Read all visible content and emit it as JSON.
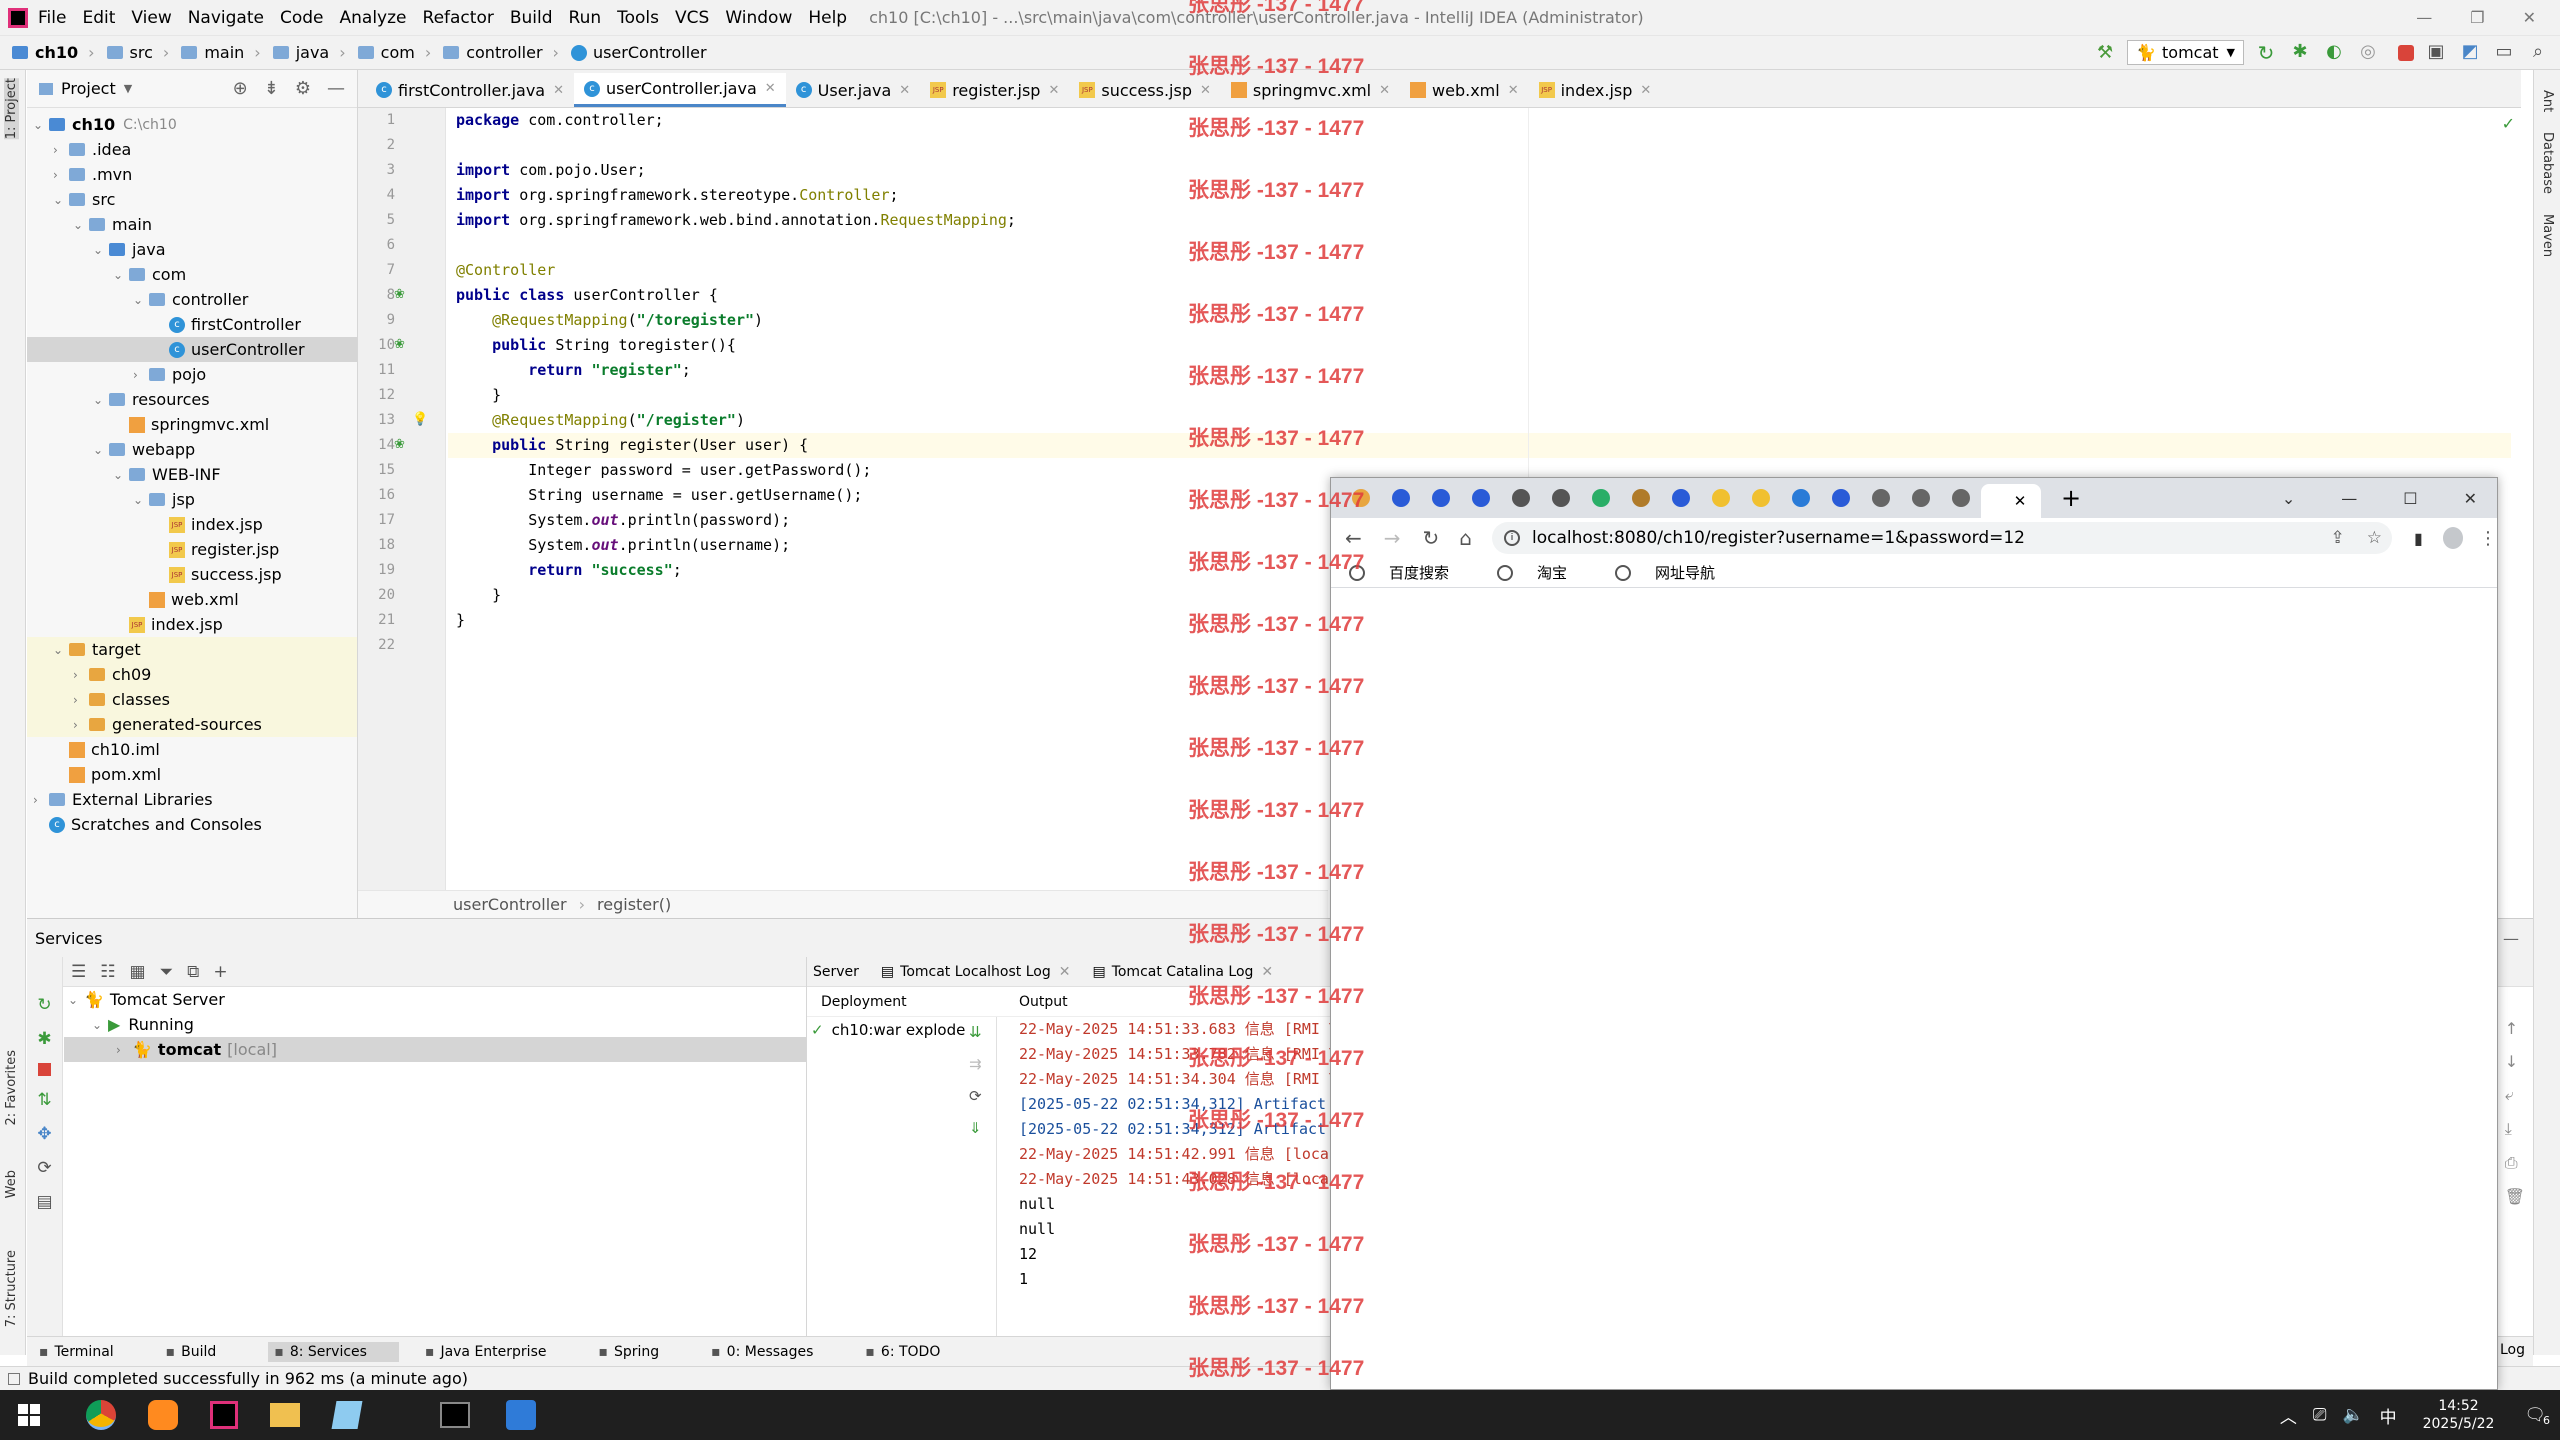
{
  "ide": {
    "menu": [
      "File",
      "Edit",
      "View",
      "Navigate",
      "Code",
      "Analyze",
      "Refactor",
      "Build",
      "Run",
      "Tools",
      "VCS",
      "Window",
      "Help"
    ],
    "title": "ch10 [C:\\ch10] - ...\\src\\main\\java\\com\\controller\\userController.java - IntelliJ IDEA (Administrator)",
    "breadcrumbs": [
      "ch10",
      "src",
      "main",
      "java",
      "com",
      "controller",
      "userController"
    ],
    "run_config": "tomcat",
    "project_label": "Project",
    "tabs": [
      "firstController.java",
      "userController.java",
      "User.java",
      "register.jsp",
      "success.jsp",
      "springmvc.xml",
      "web.xml",
      "index.jsp"
    ],
    "active_tab": 1,
    "tree": [
      {
        "label": "ch10",
        "hint": "C:\\ch10",
        "depth": 0,
        "type": "folder-b",
        "open": true,
        "bold": true
      },
      {
        "label": ".idea",
        "depth": 1,
        "type": "folder",
        "arrow": "closed"
      },
      {
        "label": ".mvn",
        "depth": 1,
        "type": "folder",
        "arrow": "closed"
      },
      {
        "label": "src",
        "depth": 1,
        "type": "folder",
        "arrow": "open"
      },
      {
        "label": "main",
        "depth": 2,
        "type": "folder",
        "arrow": "open"
      },
      {
        "label": "java",
        "depth": 3,
        "type": "folder-b",
        "arrow": "open"
      },
      {
        "label": "com",
        "depth": 4,
        "type": "folder",
        "arrow": "open"
      },
      {
        "label": "controller",
        "depth": 5,
        "type": "folder",
        "arrow": "open"
      },
      {
        "label": "firstController",
        "depth": 6,
        "type": "java"
      },
      {
        "label": "userController",
        "depth": 6,
        "type": "java",
        "selected": true
      },
      {
        "label": "pojo",
        "depth": 5,
        "type": "folder",
        "arrow": "closed"
      },
      {
        "label": "resources",
        "depth": 3,
        "type": "folder",
        "arrow": "open"
      },
      {
        "label": "springmvc.xml",
        "depth": 4,
        "type": "xml"
      },
      {
        "label": "webapp",
        "depth": 3,
        "type": "folder",
        "arrow": "open"
      },
      {
        "label": "WEB-INF",
        "depth": 4,
        "type": "folder",
        "arrow": "open"
      },
      {
        "label": "jsp",
        "depth": 5,
        "type": "folder",
        "arrow": "open"
      },
      {
        "label": "index.jsp",
        "depth": 6,
        "type": "jsp"
      },
      {
        "label": "register.jsp",
        "depth": 6,
        "type": "jsp"
      },
      {
        "label": "success.jsp",
        "depth": 6,
        "type": "jsp"
      },
      {
        "label": "web.xml",
        "depth": 5,
        "type": "xml"
      },
      {
        "label": "index.jsp",
        "depth": 4,
        "type": "jsp"
      },
      {
        "label": "target",
        "depth": 1,
        "type": "folder-o",
        "arrow": "open",
        "excluded": true
      },
      {
        "label": "ch09",
        "depth": 2,
        "type": "folder-o",
        "arrow": "closed",
        "excluded": true
      },
      {
        "label": "classes",
        "depth": 2,
        "type": "folder-o",
        "arrow": "closed",
        "excluded": true
      },
      {
        "label": "generated-sources",
        "depth": 2,
        "type": "folder-o",
        "arrow": "closed",
        "excluded": true
      },
      {
        "label": "ch10.iml",
        "depth": 1,
        "type": "file"
      },
      {
        "label": "pom.xml",
        "depth": 1,
        "type": "file"
      },
      {
        "label": "External Libraries",
        "depth": 0,
        "type": "lib",
        "arrow": "closed"
      },
      {
        "label": "Scratches and Consoles",
        "depth": 0,
        "type": "scratch"
      }
    ],
    "code_lines": [
      [
        [
          "kw",
          "package"
        ],
        [
          "",
          "com.controller;"
        ]
      ],
      [],
      [
        [
          "kw",
          "import"
        ],
        [
          "",
          "com.pojo.User;"
        ]
      ],
      [
        [
          "kw",
          "import"
        ],
        [
          "",
          "org.springframework.stereotype."
        ],
        [
          "an",
          "Controller"
        ],
        [
          "",
          ";"
        ]
      ],
      [
        [
          "kw",
          "import"
        ],
        [
          "",
          "org.springframework.web.bind.annotation."
        ],
        [
          "an",
          "RequestMapping"
        ],
        [
          "",
          ";"
        ]
      ],
      [],
      [
        [
          "an",
          "@Controller"
        ]
      ],
      [
        [
          "kw",
          "public class"
        ],
        [
          "",
          " userController {"
        ]
      ],
      [
        [
          "",
          "    "
        ],
        [
          "an",
          "@RequestMapping"
        ],
        [
          "",
          "("
        ],
        [
          "st",
          "\"/toregister\""
        ],
        [
          "",
          ")"
        ]
      ],
      [
        [
          "",
          "    "
        ],
        [
          "kw",
          "public"
        ],
        [
          "",
          " String toregister(){"
        ]
      ],
      [
        [
          "",
          "        "
        ],
        [
          "kw",
          "return"
        ],
        [
          "",
          " "
        ],
        [
          "st",
          "\"register\""
        ],
        [
          "",
          ";"
        ]
      ],
      [
        [
          "",
          "    }"
        ]
      ],
      [
        [
          "",
          "    "
        ],
        [
          "an",
          "@RequestMapping"
        ],
        [
          "",
          "("
        ],
        [
          "st",
          "\"/register\""
        ],
        [
          "",
          ")"
        ]
      ],
      [
        [
          "",
          "    "
        ],
        [
          "kw",
          "public"
        ],
        [
          "",
          " String register(User user) {"
        ]
      ],
      [
        [
          "",
          "        Integer password = user.getPassword();"
        ]
      ],
      [
        [
          "",
          "        String username = user.getUsername();"
        ]
      ],
      [
        [
          "",
          "        System."
        ],
        [
          "fld",
          "out"
        ],
        [
          "",
          ".println(password);"
        ]
      ],
      [
        [
          "",
          "        System."
        ],
        [
          "fld",
          "out"
        ],
        [
          "",
          ".println(username);"
        ]
      ],
      [
        [
          "",
          "        "
        ],
        [
          "kw",
          "return"
        ],
        [
          "",
          " "
        ],
        [
          "st",
          "\"success\""
        ],
        [
          "",
          ";"
        ]
      ],
      [
        [
          "",
          "    }"
        ]
      ],
      [
        [
          "",
          "}"
        ]
      ],
      []
    ],
    "current_line": 14,
    "editor_breadcrumb": [
      "userController",
      "register()"
    ],
    "services": {
      "title": "Services",
      "tree": [
        "Tomcat Server",
        "Running",
        "tomcat"
      ],
      "tomcat_hint": "[local]",
      "tabs": [
        "Server",
        "Tomcat Localhost Log",
        "Tomcat Catalina Log"
      ],
      "deployment_label": "Deployment",
      "output_label": "Output",
      "deployment_item": "ch10:war explode",
      "output_lines": [
        {
          "text": "22-May-2025 14:51:33.683 信息 [RMI T",
          "color": "#c0392b"
        },
        {
          "text": "22-May-2025 14:51:33.782 信息 [RMI T",
          "color": "#c0392b"
        },
        {
          "text": "22-May-2025 14:51:34.304 信息 [RMI T",
          "color": "#c0392b"
        },
        {
          "text": "[2025-05-22 02:51:34,312] Artifact c",
          "color": "#1a4f9c"
        },
        {
          "text": "[2025-05-22 02:51:34,312] Artifact c",
          "color": "#1a4f9c"
        },
        {
          "text": "22-May-2025 14:51:42.991 信息 [local",
          "color": "#c0392b"
        },
        {
          "text": "22-May-2025 14:51:43.028 信息 [local",
          "color": "#c0392b"
        },
        {
          "text": "null",
          "color": "#000000"
        },
        {
          "text": "null",
          "color": "#000000"
        },
        {
          "text": "12",
          "color": "#000000"
        },
        {
          "text": "1",
          "color": "#000000"
        }
      ]
    },
    "bottom_tabs": [
      "Terminal",
      "Build",
      "8: Services",
      "Java Enterprise",
      "Spring",
      "0: Messages",
      "6: TODO"
    ],
    "status": "Build completed successfully in 962 ms (a minute ago)",
    "event_log": "Log",
    "side_left": [
      "1: Project",
      "2: Favorites",
      "Web",
      "7: Structure"
    ],
    "side_right": [
      "Ant",
      "Database",
      "Maven"
    ]
  },
  "browser": {
    "url": "localhost:8080/ch10/register?username=1&password=12",
    "bookmarks": [
      "百度搜索",
      "淘宝",
      "网址导航"
    ],
    "new_tab": "+"
  },
  "taskbar": {
    "time": "14:52",
    "date": "2025/5/22",
    "ime": "中",
    "notif": "6"
  },
  "watermark": "张思彤 -137 - 1477",
  "colors": {
    "accent": "#4a86c8",
    "watermark": "#e03c3c"
  }
}
